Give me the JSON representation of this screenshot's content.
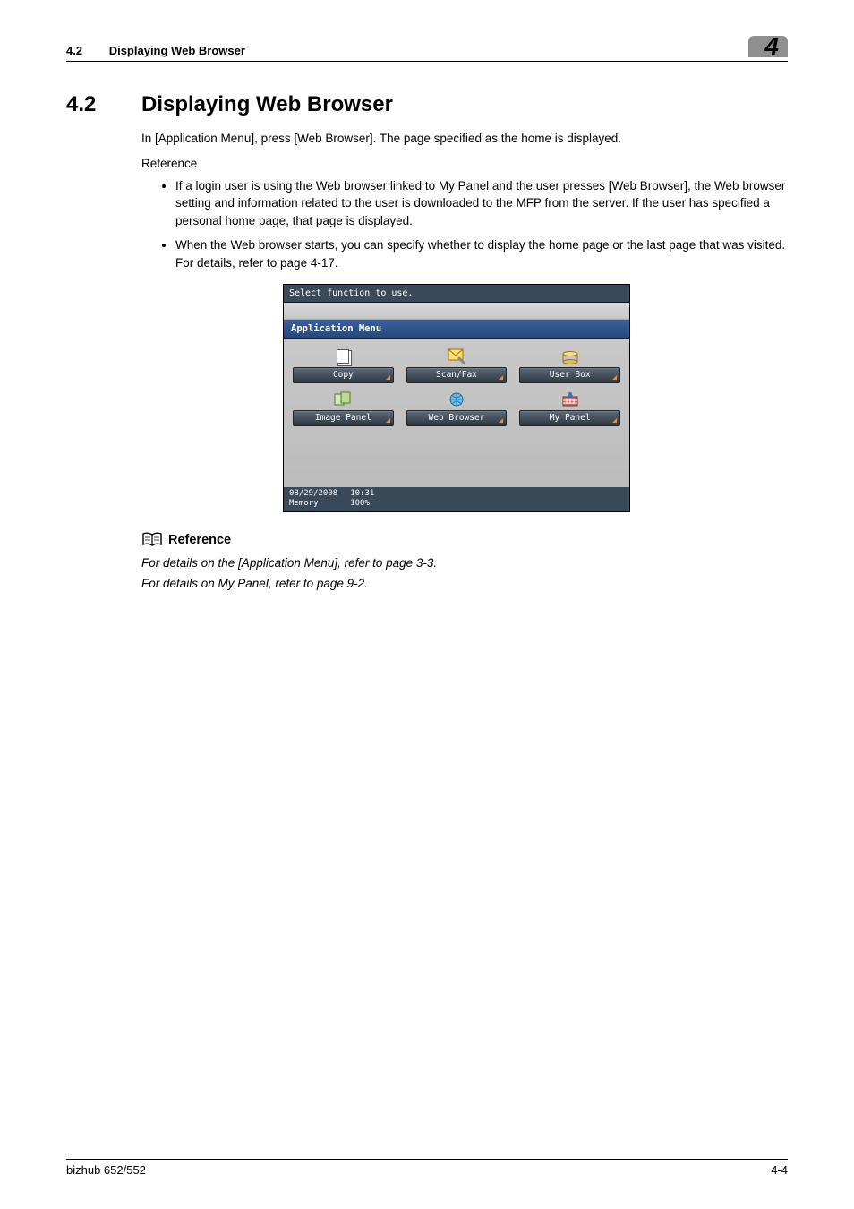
{
  "header": {
    "section_number": "4.2",
    "section_name": "Displaying Web Browser",
    "chapter_tab": "4"
  },
  "section": {
    "number": "4.2",
    "title": "Displaying Web Browser",
    "intro": "In [Application Menu], press [Web Browser]. The page specified as the home is displayed.",
    "reference_label": "Reference",
    "bullets": [
      "If a login user is using the Web browser linked to My Panel and the user presses [Web Browser], the Web browser setting and information related to the user is downloaded to the MFP from the server. If the user has specified a personal home page, that page is displayed.",
      "When the Web browser starts, you can specify whether to display the home page or the last page that was visited. For details, refer to page 4-17."
    ]
  },
  "mfp": {
    "instruction": "Select function to use.",
    "menu_title": "Application Menu",
    "buttons": {
      "copy": "Copy",
      "scanfax": "Scan/Fax",
      "userbox": "User Box",
      "imagepanel": "Image Panel",
      "webbrowser": "Web Browser",
      "mypanel": "My Panel"
    },
    "status": {
      "date": "08/29/2008",
      "time": "10:31",
      "memory_label": "Memory",
      "memory_value": "100%"
    }
  },
  "reference_block": {
    "title": "Reference",
    "lines": [
      "For details on the [Application Menu], refer to page 3-3.",
      "For details on My Panel, refer to page 9-2."
    ]
  },
  "footer": {
    "left": "bizhub 652/552",
    "right": "4-4"
  }
}
